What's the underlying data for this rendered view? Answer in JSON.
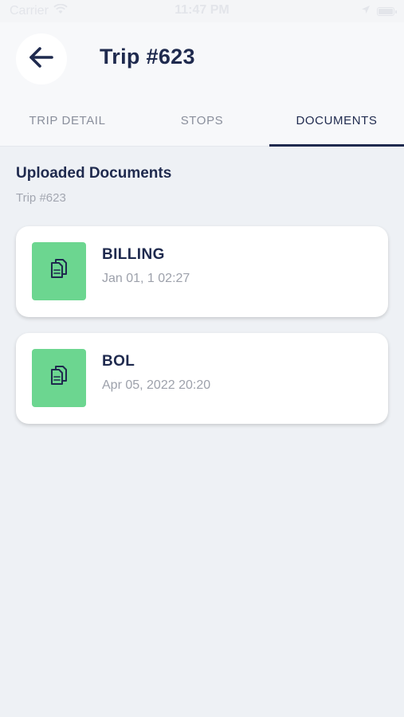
{
  "status_bar": {
    "carrier": "Carrier",
    "time": "11:47 PM",
    "battery_level": 1.0
  },
  "header": {
    "title": "Trip #623"
  },
  "tabs": [
    {
      "label": "TRIP DETAIL",
      "active": false
    },
    {
      "label": "STOPS",
      "active": false
    },
    {
      "label": "DOCUMENTS",
      "active": true
    }
  ],
  "section": {
    "title": "Uploaded Documents",
    "subtitle": "Trip #623"
  },
  "documents": [
    {
      "name": "BILLING",
      "date": "Jan 01, 1 02:27",
      "icon": "documents-icon"
    },
    {
      "name": "BOL",
      "date": "Apr 05, 2022 20:20",
      "icon": "documents-icon"
    }
  ],
  "colors": {
    "primary": "#1f2a4e",
    "accent_green": "#6cd690",
    "background": "#eef1f5"
  }
}
